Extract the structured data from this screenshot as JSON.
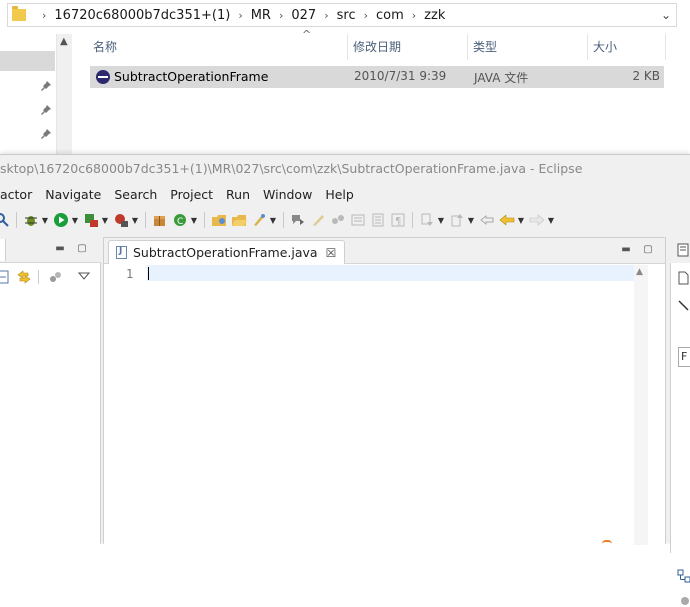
{
  "explorer": {
    "breadcrumbs": [
      "16720c68000b7dc351+(1)",
      "MR",
      "027",
      "src",
      "com",
      "zzk"
    ],
    "breadcrumb_separator": "›",
    "dropdown_glyph": "⌄",
    "columns": {
      "name": "名称",
      "date": "修改日期",
      "type": "类型",
      "size": "大小"
    },
    "file": {
      "name": "SubtractOperationFrame",
      "date": "2010/7/31 9:39",
      "type": "JAVA 文件",
      "size": "2 KB"
    }
  },
  "eclipse": {
    "title": "sktop\\16720c68000b7dc351+(1)\\MR\\027\\src\\com\\zzk\\SubtractOperationFrame.java - Eclipse",
    "menus": [
      "actor",
      "Navigate",
      "Search",
      "Project",
      "Run",
      "Window",
      "Help"
    ],
    "editor": {
      "tab_label": "SubtractOperationFrame.java",
      "tab_close": "☒",
      "line_number": "1"
    },
    "right_field_text": "F",
    "colors": {
      "accent_current_line": "#e8f2fe",
      "run_green": "#1a9e3a",
      "debug_red": "#c0392b"
    }
  }
}
